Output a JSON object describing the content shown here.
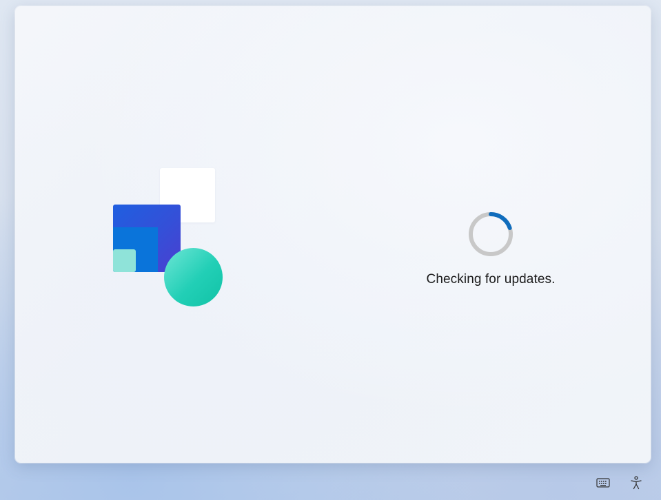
{
  "status": {
    "message": "Checking for updates."
  },
  "colors": {
    "spinner_track": "#c8c8c8",
    "spinner_arc": "#0f6cbd",
    "illustration_blue": "#3450d8",
    "illustration_teal": "#22cfb6",
    "illustration_mint": "#8fe3d9"
  },
  "tray": {
    "icons": [
      "keyboard-icon",
      "accessibility-icon"
    ]
  }
}
